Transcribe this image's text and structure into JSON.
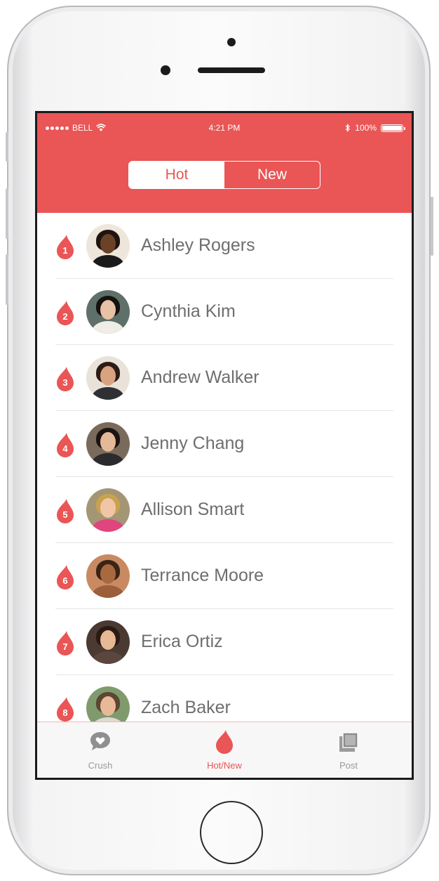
{
  "status_bar": {
    "carrier": "BELL",
    "time": "4:21 PM",
    "battery": "100%"
  },
  "segment": {
    "hot_label": "Hot",
    "new_label": "New",
    "selected": "Hot"
  },
  "list": {
    "items": [
      {
        "rank": "1",
        "name": "Ashley Rogers"
      },
      {
        "rank": "2",
        "name": "Cynthia Kim"
      },
      {
        "rank": "3",
        "name": "Andrew Walker"
      },
      {
        "rank": "4",
        "name": "Jenny Chang"
      },
      {
        "rank": "5",
        "name": "Allison Smart"
      },
      {
        "rank": "6",
        "name": "Terrance Moore"
      },
      {
        "rank": "7",
        "name": "Erica Ortiz"
      },
      {
        "rank": "8",
        "name": "Zach Baker"
      }
    ]
  },
  "tabbar": {
    "items": [
      {
        "label": "Crush",
        "icon": "heart-bubble-icon"
      },
      {
        "label": "Hot/New",
        "icon": "flame-icon"
      },
      {
        "label": "Post",
        "icon": "photos-icon"
      }
    ],
    "active": "Hot/New"
  },
  "colors": {
    "accent": "#ea5555",
    "text": "#6e6e6e",
    "tab_inactive": "#9a9a9a"
  }
}
